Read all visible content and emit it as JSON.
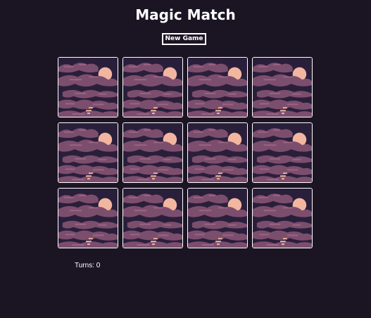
{
  "game": {
    "title": "Magic Match",
    "new_game_label": "New Game",
    "turns_label": "Turns: 0"
  },
  "board": {
    "rows": 3,
    "columns": 4,
    "cards": [
      {
        "face": "card-back"
      },
      {
        "face": "card-back"
      },
      {
        "face": "card-back"
      },
      {
        "face": "card-back"
      },
      {
        "face": "card-back"
      },
      {
        "face": "card-back"
      },
      {
        "face": "card-back"
      },
      {
        "face": "card-back"
      },
      {
        "face": "card-back"
      },
      {
        "face": "card-back"
      },
      {
        "face": "card-back"
      },
      {
        "face": "card-back"
      }
    ]
  },
  "colors": {
    "background": "#1b1523",
    "card_sky": "#2a1f3b",
    "cloud": "#7c4e6e",
    "cloud_light": "#a4698a",
    "moon": "#f2b6a0",
    "card_border": "#ffffff"
  }
}
